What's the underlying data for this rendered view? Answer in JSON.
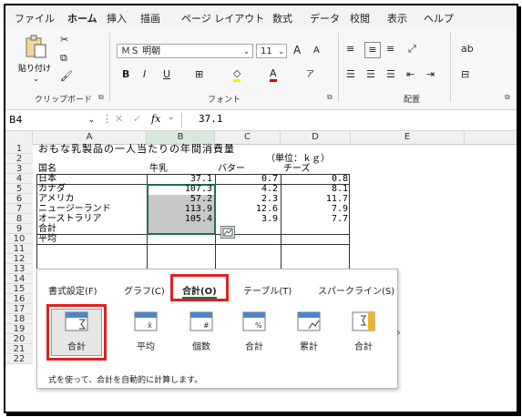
{
  "menu": {
    "items": [
      "ファイル",
      "ホーム",
      "挿入",
      "描画",
      "ページ レイアウト",
      "数式",
      "データ",
      "校閲",
      "表示",
      "ヘルプ"
    ]
  },
  "ribbon": {
    "clipboard": {
      "paste": "貼り付け",
      "label": "クリップボード"
    },
    "font": {
      "name": "ＭＳ 明朝",
      "size": "11",
      "bold": "B",
      "italic": "I",
      "underline": "U",
      "increase": "A",
      "decrease": "A",
      "label": "フォント"
    },
    "alignment": {
      "label": "配置"
    }
  },
  "formula_bar": {
    "name_box": "B4",
    "fx": "fx",
    "value": "37.1"
  },
  "columns": [
    "A",
    "B",
    "C",
    "D",
    "E"
  ],
  "rows": [
    "1",
    "2",
    "3",
    "4",
    "5",
    "6",
    "7",
    "8",
    "9",
    "10",
    "11",
    "12",
    "13",
    "14",
    "15",
    "16",
    "17",
    "18",
    "19",
    "20",
    "21",
    "22"
  ],
  "sheet": {
    "title": "おもな乳製品の一人当たりの年間消費量",
    "unit": "（単位：ｋｇ）",
    "headers": [
      "国名",
      "牛乳",
      "バター",
      "チーズ"
    ],
    "data": [
      {
        "country": "日本",
        "milk": "37.1",
        "butter": "0.7",
        "cheese": "0.8"
      },
      {
        "country": "カナダ",
        "milk": "107.3",
        "butter": "4.2",
        "cheese": "8.1"
      },
      {
        "country": "アメリカ",
        "milk": "57.2",
        "butter": "2.3",
        "cheese": "11.7"
      },
      {
        "country": "ニュージーランド",
        "milk": "113.9",
        "butter": "12.6",
        "cheese": "7.9"
      },
      {
        "country": "オーストラリア",
        "milk": "105.4",
        "butter": "3.9",
        "cheese": "7.7"
      }
    ],
    "total_label": "合計",
    "avg_label": "平均"
  },
  "quick_analysis": {
    "tabs": [
      "書式設定(F)",
      "グラフ(C)",
      "合計(O)",
      "テーブル(T)",
      "スパークライン(S)"
    ],
    "items": [
      "合計",
      "平均",
      "個数",
      "合計",
      "累計",
      "合計"
    ],
    "more": "›",
    "description": "式を使って、合計を自動的に計算します。"
  },
  "colors": {
    "accent": "#1e7145",
    "highlight": "#e02020",
    "selection": "#c8c8c8"
  }
}
